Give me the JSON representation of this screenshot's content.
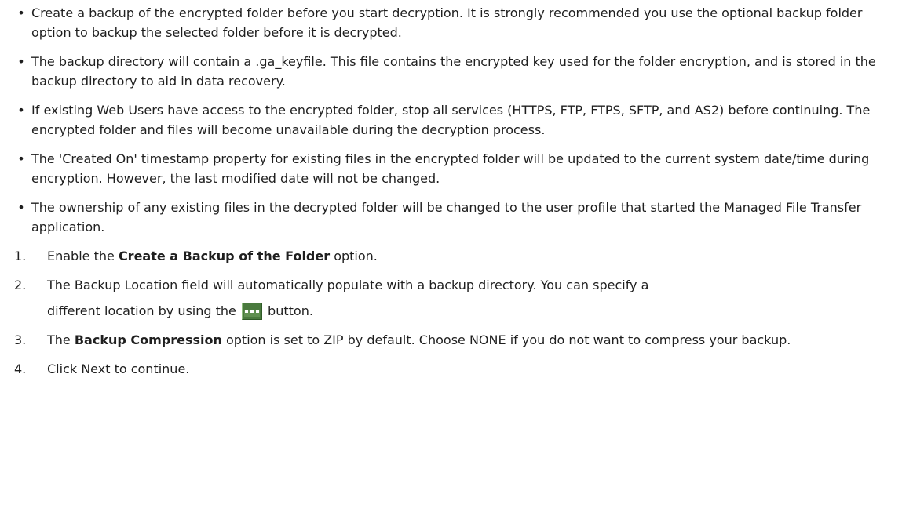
{
  "bullets": [
    "Create a backup of the encrypted folder before you start decryption. It is strongly recommended you use the optional backup folder option to backup the selected folder before it is decrypted.",
    "The backup directory will contain a .ga_keyfile. This file contains the encrypted key used for the folder encryption, and is stored in the backup directory to aid in data recovery.",
    "If existing Web Users have access to the encrypted folder, stop all services (HTTPS, FTP, FTPS, SFTP, and AS2) before continuing. The encrypted folder and files will become unavailable during the decryption process.",
    "The 'Created On' timestamp property for existing files in the encrypted folder will be updated to the current system date/time during encryption. However, the last modified date will not be changed.",
    "The ownership of any existing files in the decrypted folder will be changed to the user profile that started the Managed File Transfer application."
  ],
  "bullet_symbol": "•",
  "steps": [
    {
      "num": "1.",
      "pre": "Enable the ",
      "bold": "Create a Backup of the Folder",
      "post": " option."
    },
    {
      "num": "2.",
      "pre": "The Backup Location field will automatically populate with a backup directory. You can specify a",
      "pre2": "different location by using the ",
      "post": " button."
    },
    {
      "num": "3.",
      "pre": "The ",
      "bold": "Backup Compression",
      "post": " option is set to ZIP by default. Choose NONE if you do not want to compress your backup."
    },
    {
      "num": "4.",
      "pre": "Click Next to continue."
    }
  ],
  "icons": {
    "browse_button": "ellipsis-browse-icon",
    "browse_button_color": "#4a7a3e"
  }
}
